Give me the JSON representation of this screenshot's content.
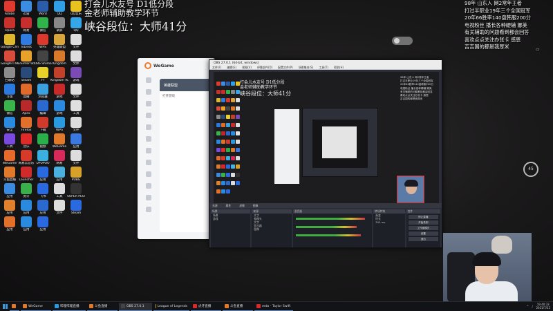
{
  "overlay": {
    "left_line1": "打会儿水友号 D1低分段",
    "left_line2": "金老师辅助教学环节",
    "left_line3": "峡谷段位：大师41分",
    "right_lines": [
      "98年  山东人  网2常年王者",
      "打过半职业19年三个全国冠军",
      "20年66胜率140盘韩服200分",
      "电视粉丝  播长各种硬辅  娜美",
      "有关辅助的问题看到都会回答",
      "喜欢点点关注办张卡  感恩",
      "吉吉国的都是我厚米"
    ]
  },
  "desktop_icons": [
    {
      "label": "Adobe",
      "color": "#e03a2f"
    },
    {
      "label": "迅雷",
      "color": "#3a8de0"
    },
    {
      "label": "Word",
      "color": "#2b5caa"
    },
    {
      "label": "QQ",
      "color": "#2fa0e8"
    },
    {
      "label": "QQ音乐",
      "color": "#e8c21e"
    },
    {
      "label": "Opera",
      "color": "#c9312c"
    },
    {
      "label": "网易",
      "color": "#c72e2e"
    },
    {
      "label": "微信",
      "color": "#2fb34a"
    },
    {
      "label": "录屏",
      "color": "#888888"
    },
    {
      "label": "QQ",
      "color": "#35a6e8"
    },
    {
      "label": "Google Chrome",
      "color": "#e0b82c"
    },
    {
      "label": "ToDesk",
      "color": "#2f7be0"
    },
    {
      "label": "WPS",
      "color": "#d93a2c"
    },
    {
      "label": "英雄联盟",
      "color": "#d8a53c"
    },
    {
      "label": "文件",
      "color": "#dddddd"
    },
    {
      "label": "Google Chrome",
      "color": "#d94b3a"
    },
    {
      "label": "Counter-Strike",
      "color": "#e8a22a"
    },
    {
      "label": "OBS Studio",
      "color": "#444444"
    },
    {
      "label": "Kingdom",
      "color": "#d87a2a"
    },
    {
      "label": "文件",
      "color": "#dddddd"
    },
    {
      "label": "回收站",
      "color": "#8c8c8c"
    },
    {
      "label": "Steam",
      "color": "#2a4a7a"
    },
    {
      "label": "YY",
      "color": "#e8d22a"
    },
    {
      "label": "Kingdom Rush",
      "color": "#c3412a"
    },
    {
      "label": "游戏",
      "color": "#7a4ab5"
    },
    {
      "label": "斗鱼",
      "color": "#2a7ae0"
    },
    {
      "label": "直播",
      "color": "#e06a2a"
    },
    {
      "label": "浏览器",
      "color": "#3aa0e0"
    },
    {
      "label": "游戏",
      "color": "#c82a2a"
    },
    {
      "label": "文件",
      "color": "#dddddd"
    },
    {
      "label": "微信",
      "color": "#3ab34a"
    },
    {
      "label": "Apex",
      "color": "#b82a2a"
    },
    {
      "label": "编辑",
      "color": "#2a6ad0"
    },
    {
      "label": "游戏",
      "color": "#2a8ae0"
    },
    {
      "label": "工具",
      "color": "#e0e0e0"
    },
    {
      "label": "安全",
      "color": "#2a8ae0"
    },
    {
      "label": "Firefox",
      "color": "#e0702a"
    },
    {
      "label": "下载",
      "color": "#d03a2a"
    },
    {
      "label": "WPS",
      "color": "#2a9ae0"
    },
    {
      "label": "文件",
      "color": "#dddddd"
    },
    {
      "label": "工具",
      "color": "#7a4ae0"
    },
    {
      "label": "音乐",
      "color": "#e02a2a"
    },
    {
      "label": "视频",
      "color": "#2ab04a"
    },
    {
      "label": "WeGame",
      "color": "#e07a2a"
    },
    {
      "label": "应用",
      "color": "#3a7ae0"
    },
    {
      "label": "WeGame",
      "color": "#e86a2a"
    },
    {
      "label": "网易云音乐",
      "color": "#d83a2a"
    },
    {
      "label": "UPUPOO",
      "color": "#3ab0e0"
    },
    {
      "label": "网易",
      "color": "#d82a5a"
    },
    {
      "label": "文件",
      "color": "#dddddd"
    },
    {
      "label": "斗鱼直播",
      "color": "#e07a2a"
    },
    {
      "label": "Launcher",
      "color": "#d02a2a"
    },
    {
      "label": "应用",
      "color": "#2a6ae0"
    },
    {
      "label": "应用",
      "color": "#4ab0e0"
    },
    {
      "label": "PUBG",
      "color": "#d8a22a"
    },
    {
      "label": "应用",
      "color": "#3a8ae0"
    },
    {
      "label": "虎牙",
      "color": "#3ab04a"
    },
    {
      "label": "飞书",
      "color": "#2a6ae0"
    },
    {
      "label": "工具",
      "color": "#dddddd"
    },
    {
      "label": "SUPER PEOPLE",
      "color": "#333333"
    },
    {
      "label": "应用",
      "color": "#e0802a"
    },
    {
      "label": "应用",
      "color": "#2a8ae0"
    },
    {
      "label": "应用",
      "color": "#2a6ad0"
    },
    {
      "label": "文件",
      "color": "#dddddd"
    },
    {
      "label": "Steam",
      "color": "#2a6ae0"
    },
    {
      "label": "应用",
      "color": "#e0702a"
    },
    {
      "label": "应用",
      "color": "#2a8ae0"
    },
    {
      "label": "应用",
      "color": "#2a6ae0"
    }
  ],
  "obs": {
    "title": "OBS 27.0.1 (64-bit, windows)",
    "menu": [
      "文件(F)",
      "编辑(E)",
      "视图(V)",
      "停靠部件(D)",
      "配置文件(P)",
      "场景集合(S)",
      "工具(T)",
      "帮助(H)"
    ],
    "status_bar": [
      "无源",
      "属性",
      "滤镜",
      "图像"
    ],
    "docks": {
      "scenes_header": "场景",
      "scenes": [
        "场景",
        "游戏"
      ],
      "sources_header": "来源",
      "sources": [
        "文字",
        "摄像头",
        "文字",
        "显示器",
        "图像"
      ],
      "mixer_header": "混音器",
      "transitions_header": "转场特效",
      "transition": "渐变",
      "duration_label": "时长",
      "duration": "300 ms",
      "controls_header": "控件",
      "controls": [
        "停止直播",
        "开始录制",
        "工作室模式",
        "设置",
        "退出"
      ]
    }
  },
  "wegame": {
    "title": "WeGame",
    "banner": "英雄联盟",
    "text": "打开游戏"
  },
  "taskbar": {
    "items": [
      {
        "label": "",
        "color": "#e07a2a"
      },
      {
        "label": "WeGame",
        "color": "#e07a2a"
      },
      {
        "label": "哔哩哔哩直播",
        "color": "#2a9ae0"
      },
      {
        "label": "斗鱼直播",
        "color": "#e07a2a"
      },
      {
        "label": "OBS 27.0.1",
        "color": "#444444"
      },
      {
        "label": "League of Legends",
        "color": "#c8a23a"
      },
      {
        "label": "虎牙直播",
        "color": "#d82a2a"
      },
      {
        "label": "斗鱼直播",
        "color": "#e07a2a"
      },
      {
        "label": "redo - Taylor Swift",
        "color": "#d82a2a"
      }
    ],
    "time": "19:40:33",
    "date": "2021/7/22"
  }
}
